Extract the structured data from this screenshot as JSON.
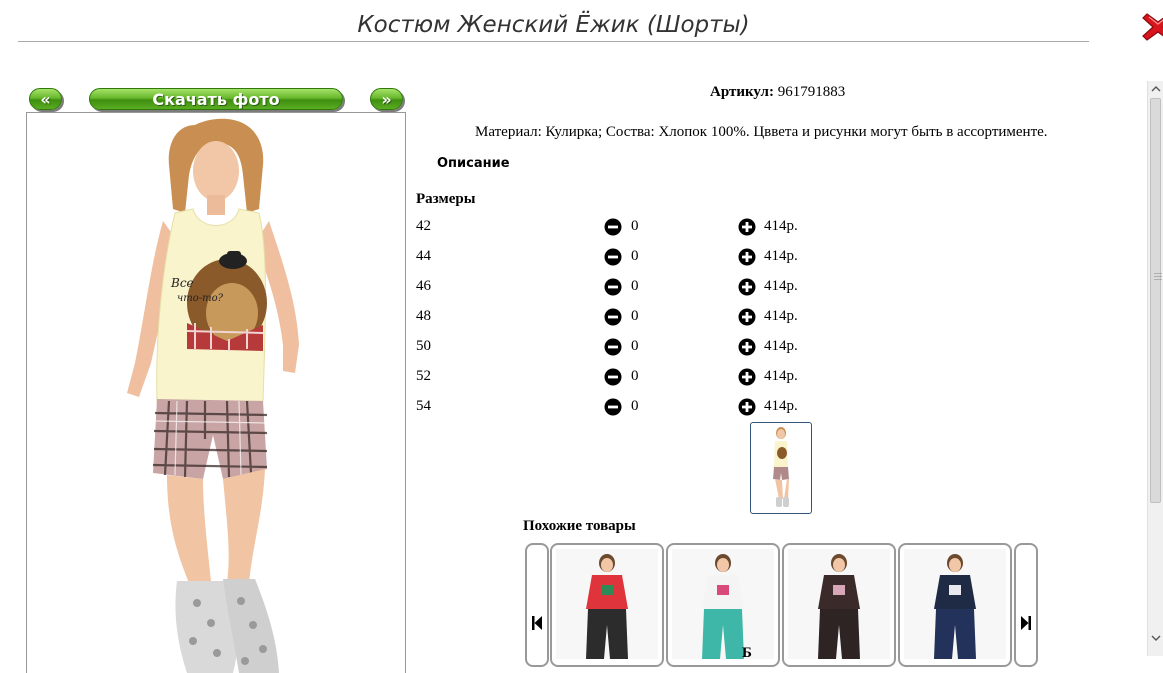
{
  "product": {
    "title": "Костюм Женский Ёжик (Шорты)",
    "article_label": "Артикул:",
    "article_value": "961791883",
    "material": "Материал: Кулирка; Соства: Хлопок 100%. Цввета и рисунки могут быть в ассортименте.",
    "description_tab": "Описание",
    "sizes_header": "Размеры"
  },
  "photo_nav": {
    "prev_label": "«",
    "download_label": "Скачать фото",
    "next_label": "»"
  },
  "sizes": [
    {
      "size": "42",
      "qty": "0",
      "price": "414р."
    },
    {
      "size": "44",
      "qty": "0",
      "price": "414р."
    },
    {
      "size": "46",
      "qty": "0",
      "price": "414р."
    },
    {
      "size": "48",
      "qty": "0",
      "price": "414р."
    },
    {
      "size": "50",
      "qty": "0",
      "price": "414р."
    },
    {
      "size": "52",
      "qty": "0",
      "price": "414р."
    },
    {
      "size": "54",
      "qty": "0",
      "price": "414р."
    }
  ],
  "similar": {
    "header": "Похожие товары",
    "items": [
      {
        "top_color": "#e0343c",
        "bottom_color": "#2c2c2c",
        "accent": "#2e8b57"
      },
      {
        "top_color": "#f4f4f4",
        "bottom_color": "#3fb7a8",
        "accent": "#d84a7a"
      },
      {
        "top_color": "#3a2a2a",
        "bottom_color": "#2e2424",
        "accent": "#d7a6b8"
      },
      {
        "top_color": "#1f2a44",
        "bottom_color": "#22325a",
        "accent": "#e8e8ee"
      }
    ]
  },
  "footer_cut_text": "Б",
  "icons": {
    "close": "close-icon",
    "minus": "minus-circle-icon",
    "plus": "plus-circle-icon",
    "carousel_prev": "skip-back-icon",
    "carousel_next": "skip-forward-icon"
  },
  "colors": {
    "accent_green": "#5aad22",
    "close_red": "#d8141c",
    "border_gray": "#999999"
  }
}
